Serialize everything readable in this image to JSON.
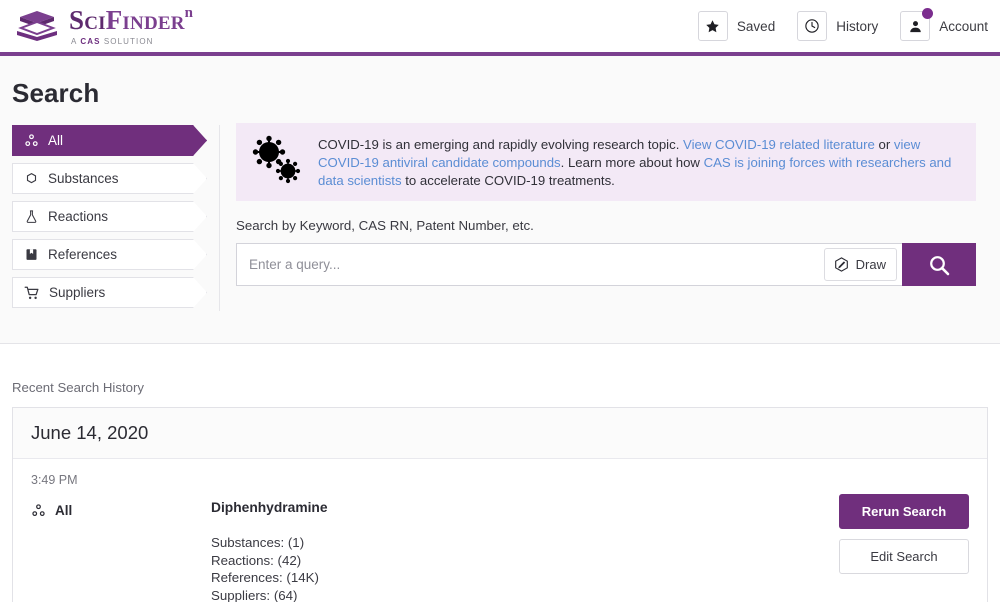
{
  "brand": {
    "name_part1": "Sci",
    "name_part2": "Finder",
    "superscript": "n",
    "tagline_a": "A ",
    "tagline_b": "CAS",
    "tagline_c": " SOLUTION",
    "purple": "#702f7d",
    "link_blue": "#5b8dd4"
  },
  "header": {
    "items": [
      {
        "label": "Saved",
        "icon": "star-icon"
      },
      {
        "label": "History",
        "icon": "clock-icon"
      },
      {
        "label": "Account",
        "icon": "person-icon"
      }
    ]
  },
  "page": {
    "title": "Search"
  },
  "sidebar": {
    "items": [
      {
        "label": "All",
        "icon": "nodes-icon",
        "active": true
      },
      {
        "label": "Substances",
        "icon": "hexagon-icon",
        "active": false
      },
      {
        "label": "Reactions",
        "icon": "flask-icon",
        "active": false
      },
      {
        "label": "References",
        "icon": "book-icon",
        "active": false
      },
      {
        "label": "Suppliers",
        "icon": "cart-icon",
        "active": false
      }
    ]
  },
  "covid_banner": {
    "icon": "coronavirus-icon",
    "text_1": "COVID-19 is an emerging and rapidly evolving research topic. ",
    "link_1": "View COVID-19 related literature",
    "text_2": " or ",
    "link_2": "view COVID-19 antiviral candidate compounds",
    "text_3": ". Learn more about how ",
    "link_3": "CAS is joining forces with researchers and data scientists",
    "text_4": " to accelerate COVID-19 treatments."
  },
  "search": {
    "label": "Search by Keyword, CAS RN, Patent Number, etc.",
    "placeholder": "Enter a query...",
    "value": "",
    "draw_label": "Draw",
    "draw_icon": "hexagon-pencil-icon",
    "submit_icon": "search-icon"
  },
  "history": {
    "section_title": "Recent Search History",
    "date": "June 14, 2020",
    "entry": {
      "time": "3:49 PM",
      "type_label": "All",
      "type_icon": "nodes-icon",
      "query": "Diphenhydramine",
      "counts": [
        "Substances: (1)",
        "Reactions: (42)",
        "References: (14K)",
        "Suppliers: (64)"
      ],
      "rerun_label": "Rerun Search",
      "edit_label": "Edit Search"
    }
  }
}
